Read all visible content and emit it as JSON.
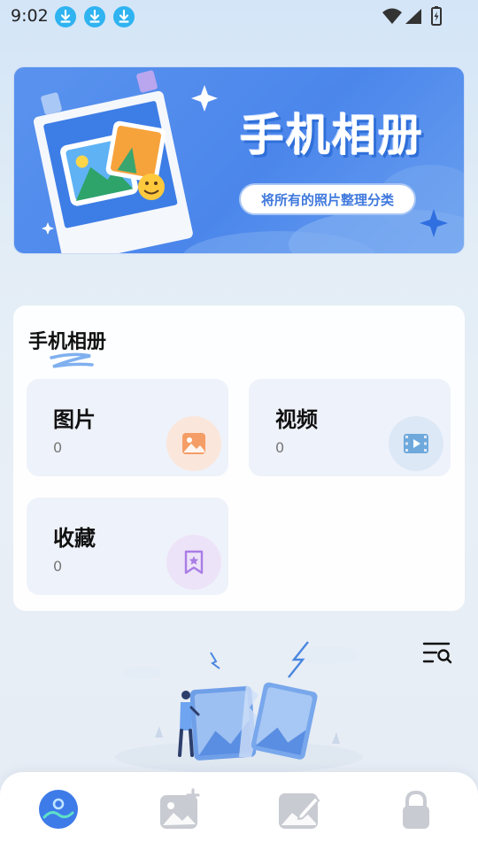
{
  "status_bar": {
    "time": "9:02",
    "notification_icons": [
      "download-icon",
      "download-icon",
      "download-icon"
    ],
    "system_icons": [
      "wifi-icon",
      "cellular-signal-icon",
      "battery-charging-icon"
    ]
  },
  "banner": {
    "title": "手机相册",
    "subtitle": "将所有的照片整理分类"
  },
  "album": {
    "title": "手机相册",
    "tiles": [
      {
        "label": "图片",
        "count": "0",
        "icon": "image-icon",
        "accent": "#f6a36a"
      },
      {
        "label": "视频",
        "count": "0",
        "icon": "video-icon",
        "accent": "#6fa9dc"
      },
      {
        "label": "收藏",
        "count": "0",
        "icon": "bookmark-star-icon",
        "accent": "#b084e8"
      }
    ]
  },
  "filter_button": {
    "icon": "list-search-icon"
  },
  "bottom_nav": {
    "items": [
      {
        "icon": "gallery-icon",
        "active": true
      },
      {
        "icon": "add-image-icon",
        "active": false
      },
      {
        "icon": "edit-image-icon",
        "active": false
      },
      {
        "icon": "lock-icon",
        "active": false
      }
    ]
  },
  "colors": {
    "accent": "#4b86eb",
    "background": "#e6ecf4",
    "card": "#ffffff",
    "tile": "#eef2fa"
  }
}
